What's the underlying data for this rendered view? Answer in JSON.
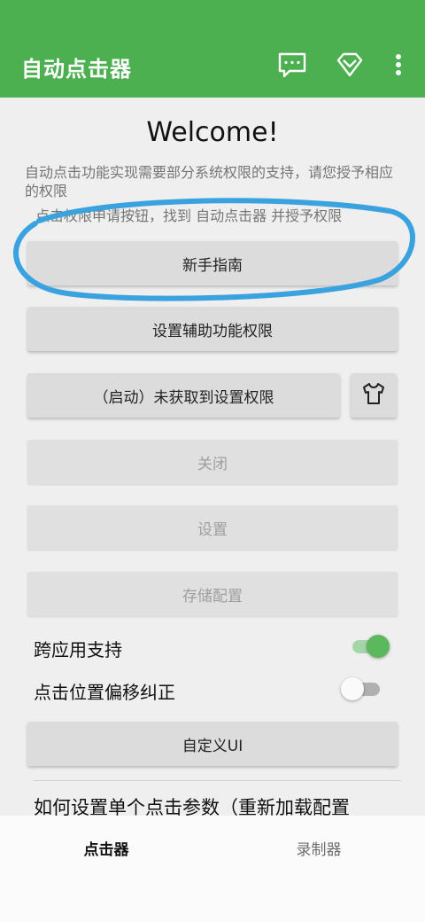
{
  "appbar": {
    "title": "自动点击器",
    "background": "#4caf50",
    "icons": [
      "chat-icon",
      "diamond-icon",
      "more-vert-icon"
    ]
  },
  "main": {
    "welcome": "Welcome!",
    "description": "自动点击功能实现需要部分系统权限的支持，请您授予相应的权限",
    "hint": "点击权限申请按钮，找到 自动点击器 并授予权限",
    "buttons": {
      "guide": "新手指南",
      "accessibility": "设置辅助功能权限",
      "start": "（启动）未获取到设置权限",
      "close": "关闭",
      "settings": "设置",
      "save_config": "存储配置",
      "custom_ui": "自定义UI"
    },
    "theme_icon": "shirt-icon",
    "switches": [
      {
        "label": "跨应用支持",
        "on": true
      },
      {
        "label": "点击位置偏移纠正",
        "on": false
      }
    ],
    "howto": "如何设置单个点击参数（重新加载配置"
  },
  "bottom_nav": {
    "tabs": [
      {
        "label": "点击器",
        "active": true
      },
      {
        "label": "录制器",
        "active": false
      }
    ]
  },
  "accent_color": "#4caf50",
  "annotation_color": "#3aa3df"
}
